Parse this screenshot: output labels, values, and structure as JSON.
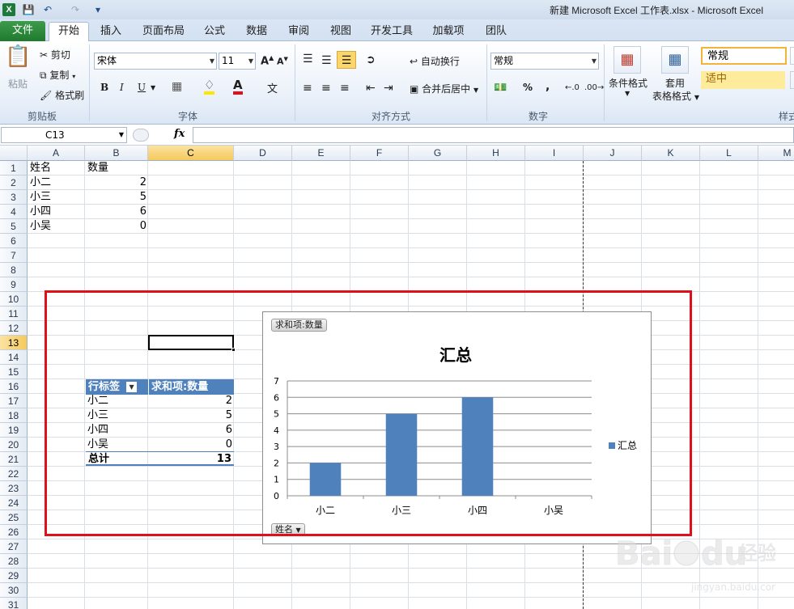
{
  "titlebar": {
    "app_letter": "X",
    "title": "新建 Microsoft Excel 工作表.xlsx  -  Microsoft Excel"
  },
  "tabs": [
    "开始",
    "插入",
    "页面布局",
    "公式",
    "数据",
    "审阅",
    "视图",
    "开发工具",
    "加载项",
    "团队"
  ],
  "file_tab": "文件",
  "ribbon": {
    "clipboard": {
      "paste": "粘贴",
      "cut": "剪切",
      "copy": "复制",
      "format_painter": "格式刷",
      "label": "剪贴板"
    },
    "font": {
      "name": "宋体",
      "size": "11",
      "label": "字体",
      "bold": "B",
      "italic": "I",
      "underline": "U"
    },
    "alignment": {
      "wrap": "自动换行",
      "merge": "合并后居中",
      "label": "对齐方式"
    },
    "number": {
      "format": "常规",
      "percent": "%",
      "comma": ",",
      "label": "数字"
    },
    "styles": {
      "conditional": "条件格式",
      "table1": "套用",
      "table2": "表格格式",
      "normal": "常规",
      "neutral": "适中",
      "label": "样式"
    }
  },
  "formula_bar": {
    "name_box": "C13",
    "fx": "fx",
    "value": ""
  },
  "columns": [
    "A",
    "B",
    "C",
    "D",
    "E",
    "F",
    "G",
    "H",
    "I",
    "J",
    "K",
    "L",
    "M"
  ],
  "rows": [
    "1",
    "2",
    "3",
    "4",
    "5",
    "6",
    "7",
    "8",
    "9",
    "10",
    "11",
    "12",
    "13",
    "14",
    "15",
    "16",
    "17",
    "18",
    "19",
    "20",
    "21",
    "22",
    "23",
    "24",
    "25",
    "26",
    "27",
    "28",
    "29",
    "30",
    "31"
  ],
  "selected": {
    "column": "C",
    "row": "13"
  },
  "sheet_data": {
    "header": [
      "姓名",
      "数量"
    ],
    "rows": [
      [
        "小二",
        "2"
      ],
      [
        "小三",
        "5"
      ],
      [
        "小四",
        "6"
      ],
      [
        "小吴",
        "0"
      ]
    ]
  },
  "pivot": {
    "row_label": "行标签",
    "value_label": "求和项:数量",
    "rows": [
      [
        "小二",
        "2"
      ],
      [
        "小三",
        "5"
      ],
      [
        "小四",
        "6"
      ],
      [
        "小吴",
        "0"
      ]
    ],
    "total_label": "总计",
    "total_value": "13"
  },
  "chart_data": {
    "type": "bar",
    "title": "汇总",
    "categories": [
      "小二",
      "小三",
      "小四",
      "小吴"
    ],
    "series": [
      {
        "name": "汇总",
        "values": [
          2,
          5,
          6,
          0
        ],
        "color": "#4f81bd"
      }
    ],
    "ylim": [
      0,
      7
    ],
    "yticks": [
      "0",
      "1",
      "2",
      "3",
      "4",
      "5",
      "6",
      "7"
    ],
    "grid": true,
    "legend": "right",
    "value_field_button": "求和项:数量",
    "axis_field_button": "姓名"
  },
  "highlight_color": "#e0101a",
  "watermark": "Baidu 经验 jingyan.baidu.com"
}
